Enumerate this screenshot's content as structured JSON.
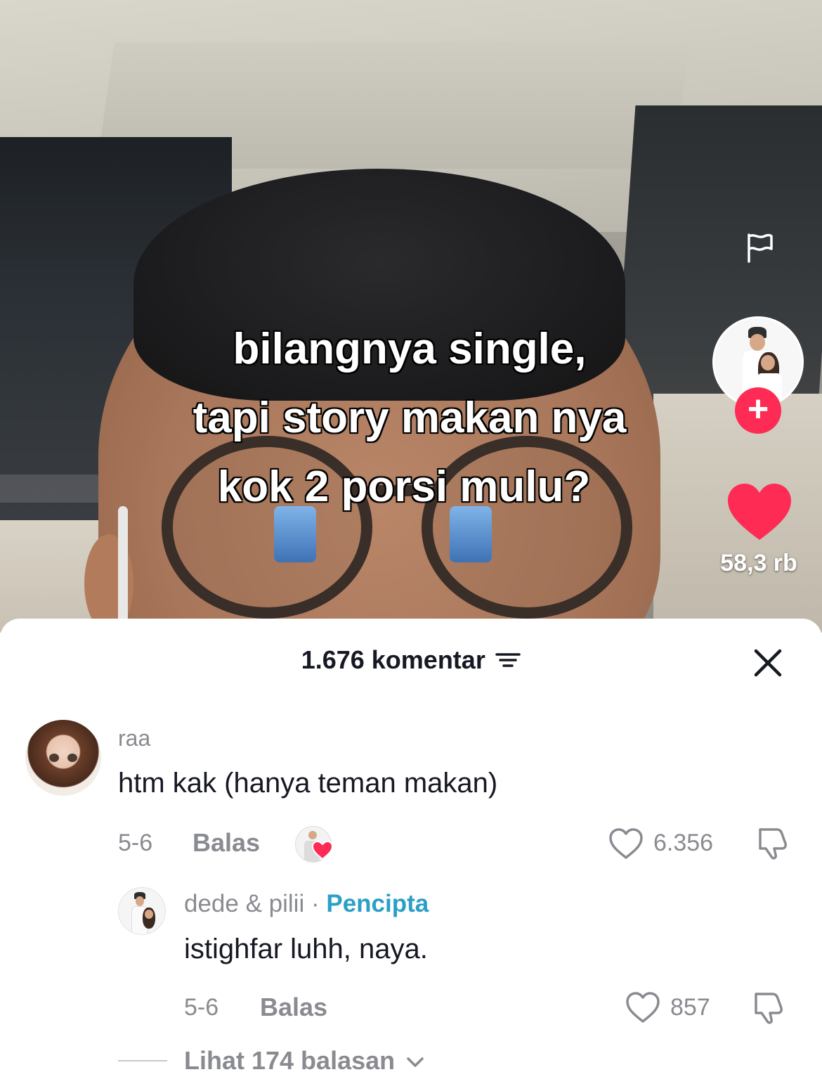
{
  "video": {
    "caption_lines": [
      "bilangnya single,",
      "tapi story makan nya",
      "kok 2 porsi mulu?"
    ],
    "like_count": "58,3 rb",
    "follow_symbol": "+"
  },
  "comments_panel": {
    "title": "1.676 komentar"
  },
  "comments": [
    {
      "username": "raa",
      "text": "htm kak (hanya teman makan)",
      "date": "5-6",
      "reply_label": "Balas",
      "like_count": "6.356"
    }
  ],
  "reply": {
    "username": "dede & pilii",
    "separator": "·",
    "creator_label": "Pencipta",
    "text": "istighfar luhh, naya.",
    "date": "5-6",
    "reply_label": "Balas",
    "like_count": "857"
  },
  "view_replies_label": "Lihat 174 balasan",
  "colors": {
    "like_red": "#fe2c55",
    "creator_blue": "#2b9fc6",
    "muted_text": "#8a8b91",
    "primary_text": "#161823"
  }
}
